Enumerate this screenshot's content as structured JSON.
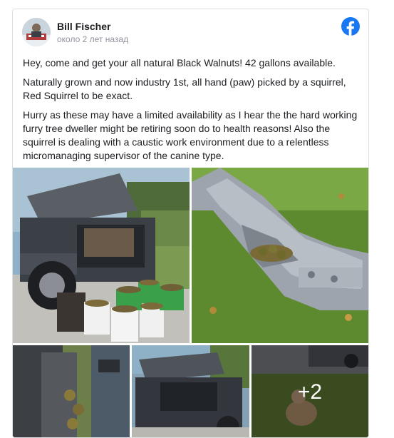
{
  "post": {
    "author": "Bill Fischer",
    "timestamp": "около 2 лет назад",
    "paragraphs": [
      "Hey, come and get your all natural Black Walnuts! 42 gallons available.",
      "Naturally grown and now industry 1st, all hand (paw) picked by a squirrel, Red Squirrel to be exact.",
      "Hurry as these may have a limited availability as I hear the the hard working furry tree dweller might be retiring soon do to health reasons! Also the squirrel is dealing with a caustic work environment due to a relentless micromanaging supervisor of the canine type."
    ],
    "more_photos_label": "+2"
  },
  "icons": {
    "platform": "facebook-icon"
  },
  "colors": {
    "facebook_blue": "#1877f2",
    "text_primary": "#1c1e21",
    "text_secondary": "#90949c",
    "card_border": "#dddfe2"
  }
}
